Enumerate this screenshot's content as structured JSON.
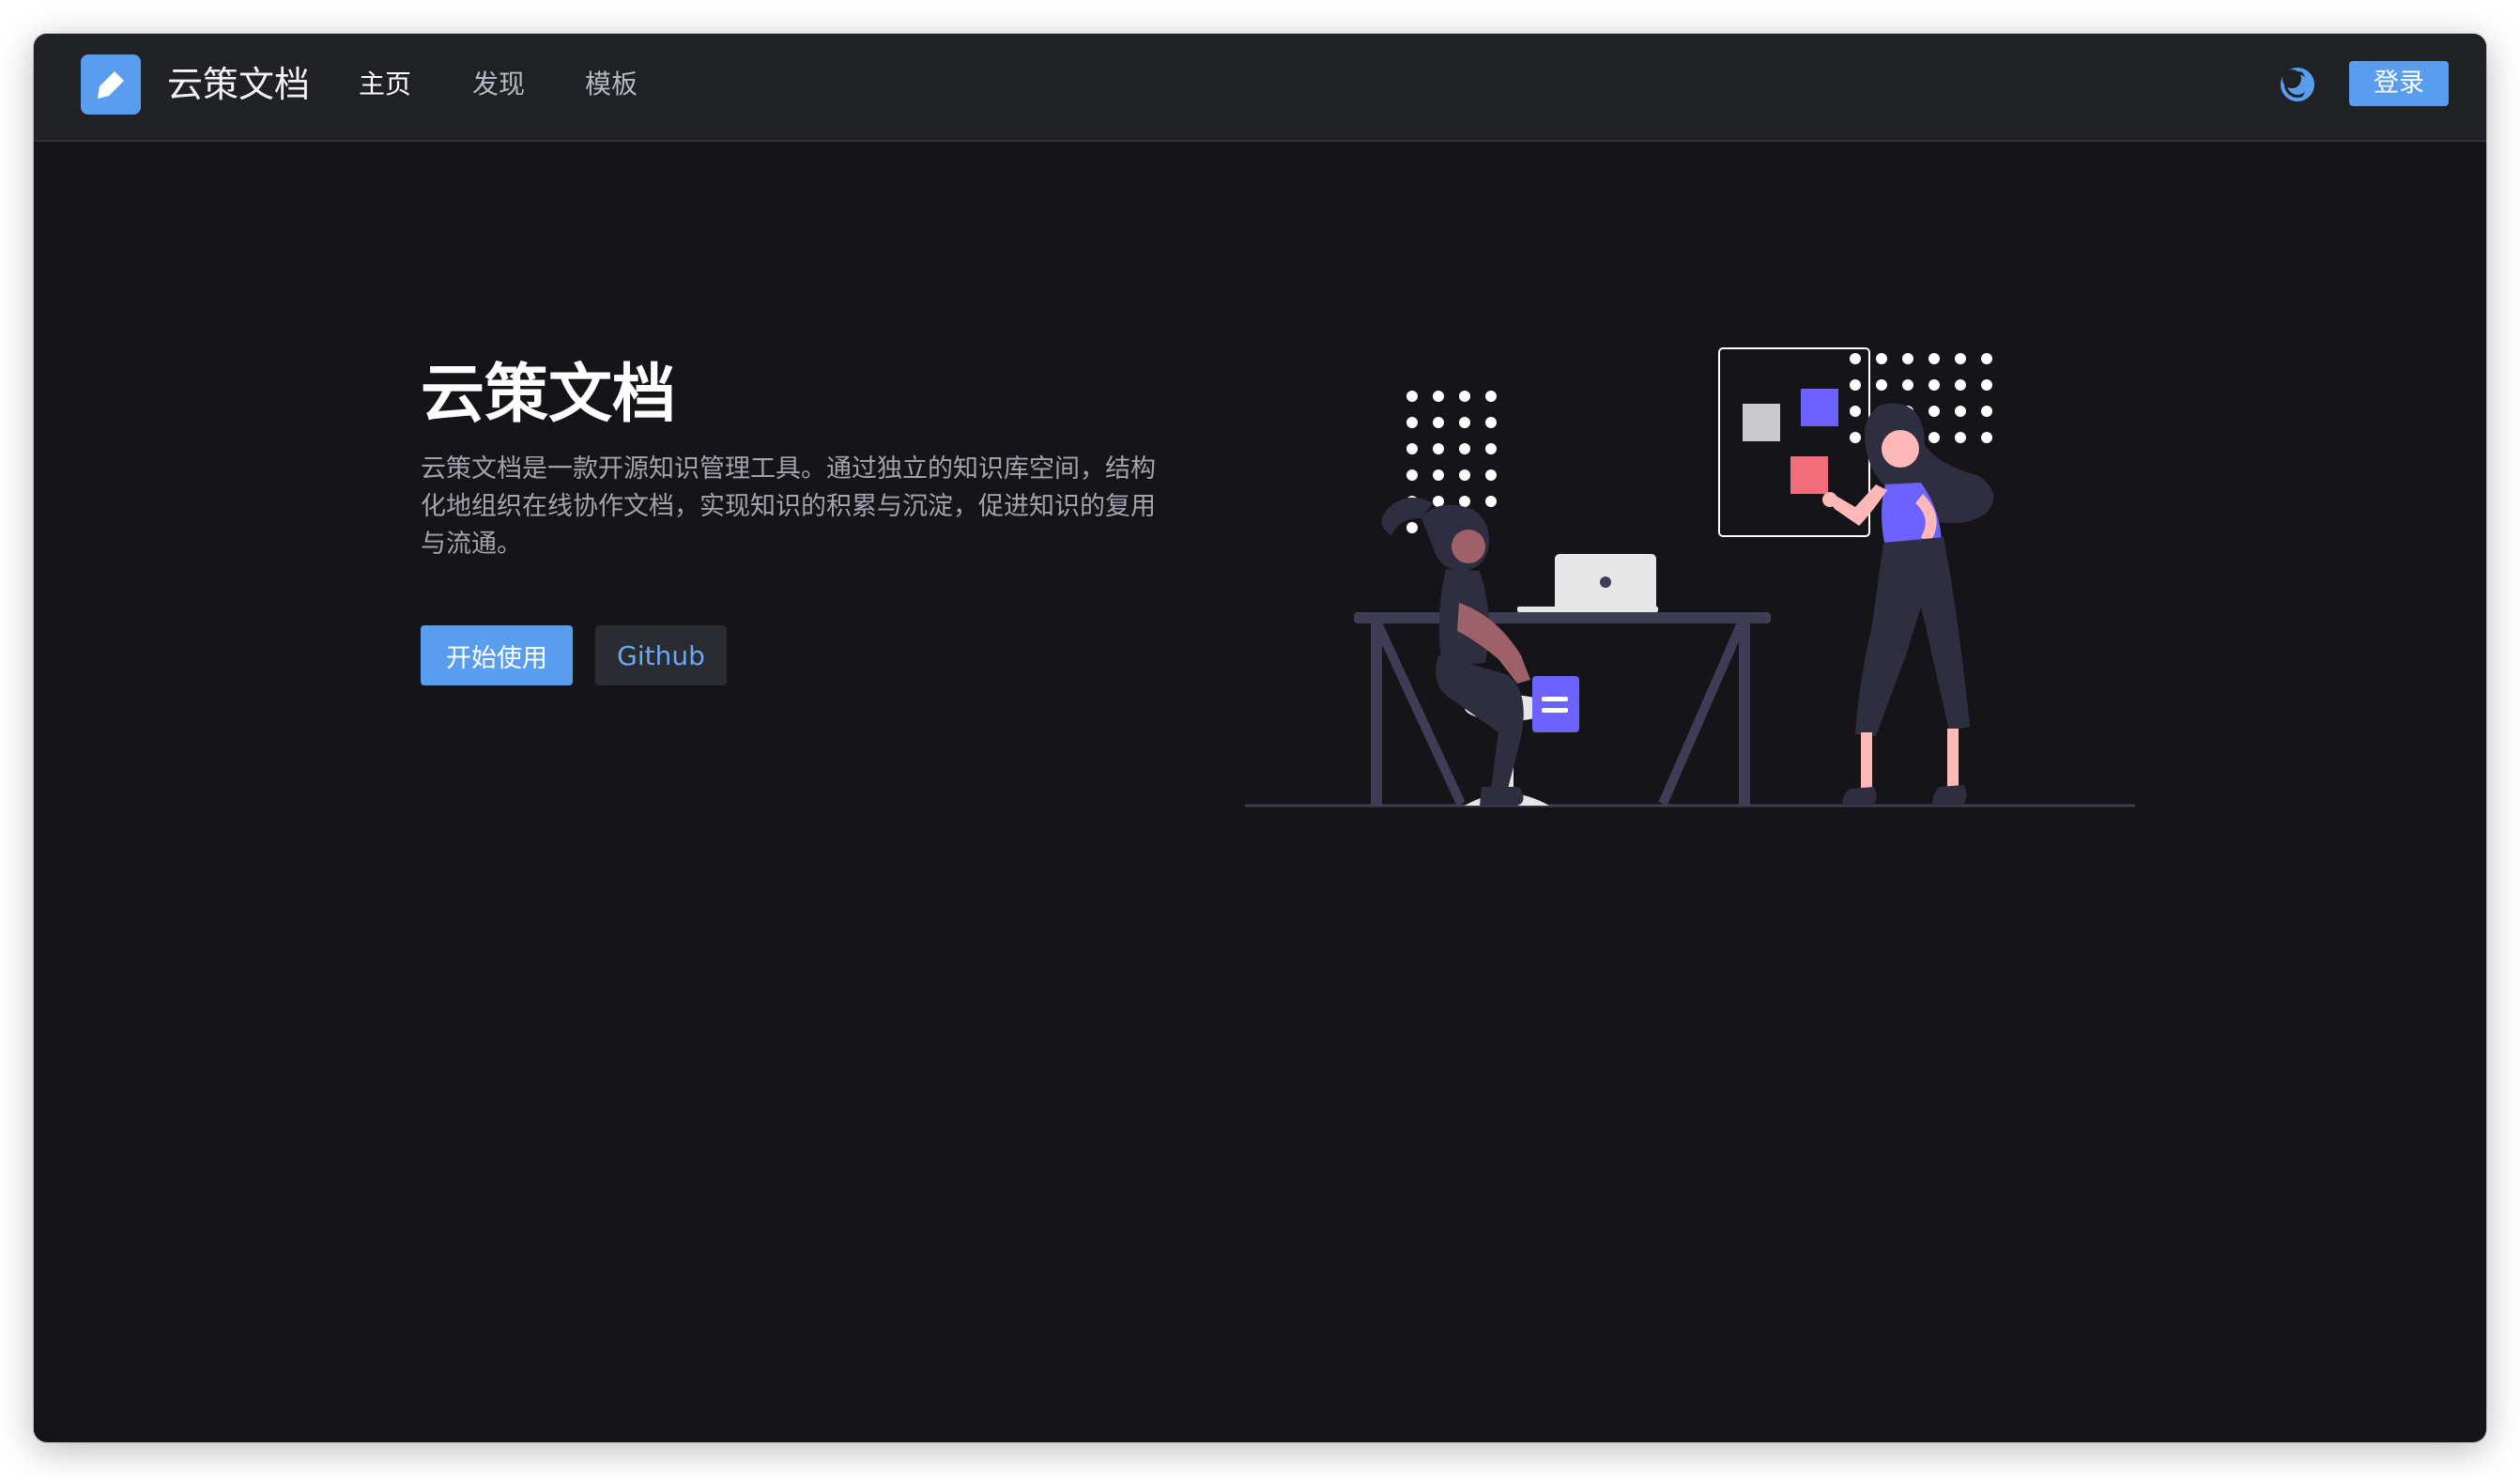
{
  "app": {
    "brand": "云策文档",
    "logo_icon": "edit-pen-icon"
  },
  "nav": {
    "items": [
      {
        "label": "主页",
        "active": true
      },
      {
        "label": "发现",
        "active": false
      },
      {
        "label": "模板",
        "active": false
      }
    ],
    "theme_icon": "moon-icon",
    "login_label": "登录"
  },
  "hero": {
    "title": "云策文档",
    "description": "云策文档是一款开源知识管理工具。通过独立的知识库空间，结构化地组织在线协作文档，实现知识的积累与沉淀，促进知识的复用与流通。",
    "primary_button": "开始使用",
    "secondary_button": "Github",
    "illustration": "team-collaboration-illustration"
  },
  "colors": {
    "accent": "#589dee",
    "page_background": "#151519",
    "navbar_background": "#202125",
    "illustration_purple": "#6c63ff",
    "illustration_pink": "#f16d7a"
  }
}
